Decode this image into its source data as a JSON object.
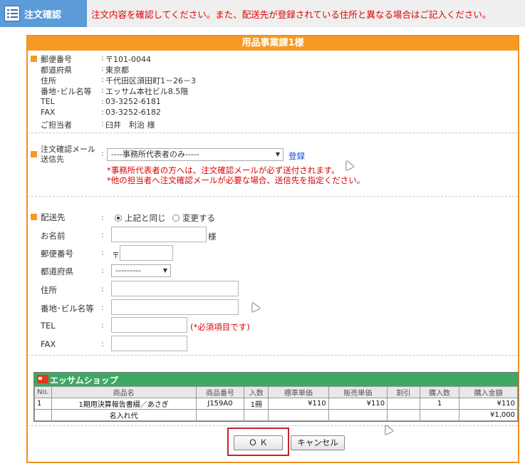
{
  "header": {
    "title": "注文確認",
    "message": "注文内容を確認してください。また、配送先が登録されている住所と異なる場合はご記入ください。"
  },
  "box": {
    "title": "用品事業課1様"
  },
  "info": [
    {
      "label": "郵便番号",
      "value": "〒101-0044"
    },
    {
      "label": "都道府県",
      "value": "東京都"
    },
    {
      "label": "住所",
      "value": "千代田区須田町1－26－3"
    },
    {
      "label": "番地･ビル名等",
      "value": "エッサム本社ビル8.5階"
    },
    {
      "label": "TEL",
      "value": "03-3252-6181"
    },
    {
      "label": "FAX",
      "value": "03-3252-6182"
    },
    {
      "label": "ご担当者",
      "value": "臼井　利治 様"
    }
  ],
  "email": {
    "label_line1": "注文確認メール",
    "label_line2": "送信先",
    "select_value": "----事務所代表者のみ-----",
    "register_link": "登録",
    "note1": "*事務所代表者の方へは、注文確認メールが必ず送付されます。",
    "note2": "*他の担当者へ注文確認メールが必要な場合、送信先を指定ください。"
  },
  "delivery": {
    "label": "配送先",
    "option_same": "上記と同じ",
    "option_change": "変更する",
    "name_label": "お名前",
    "name_suffix": "様",
    "zip_label": "郵便番号",
    "zip_prefix": "〒",
    "pref_label": "都道府県",
    "pref_value": "---------",
    "address_label": "住所",
    "building_label": "番地･ビル名等",
    "tel_label": "TEL",
    "required_note": "(*必須項目です)",
    "fax_label": "FAX"
  },
  "shop": {
    "name": "エッサムショップ",
    "columns": [
      "No.",
      "商品名",
      "商品番号",
      "入数",
      "標準単価",
      "販売単価",
      "割引",
      "購入数",
      "購入金額"
    ],
    "rows": [
      {
        "no": "1",
        "name": "1期用決算報告書綴／あさぎ",
        "code": "J159A0",
        "qty_unit": "1冊",
        "std_price": "¥110",
        "sale_price": "¥110",
        "discount": "",
        "count": "1",
        "amount": "¥110"
      },
      {
        "no": "",
        "name": "名入れ代",
        "code": "",
        "qty_unit": "",
        "std_price": "",
        "sale_price": "",
        "discount": "",
        "count": "",
        "amount": "¥1,000"
      }
    ]
  },
  "buttons": {
    "ok": "Ｏ Ｋ",
    "cancel": "キャンセル"
  },
  "colors": {
    "accent_orange": "#f59a25",
    "header_blue": "#5a9bd8",
    "alert_red": "#e00000",
    "shop_green": "#3fa862"
  }
}
